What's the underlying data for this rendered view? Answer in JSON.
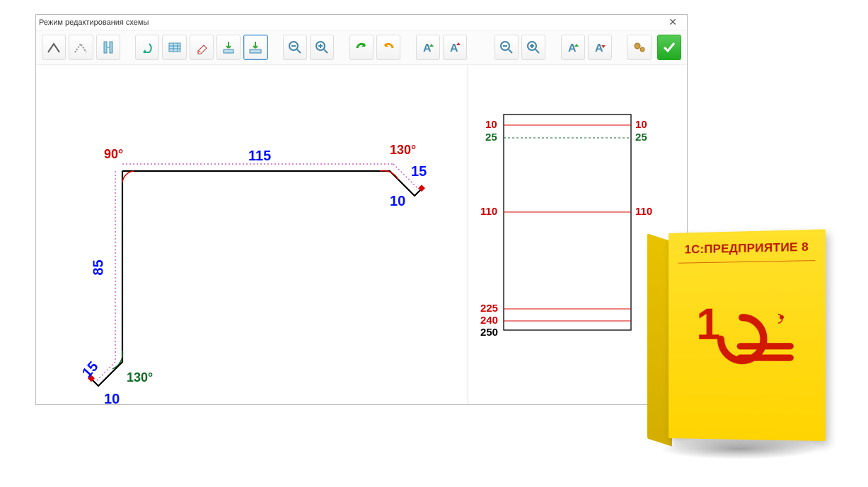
{
  "window": {
    "title": "Режим редактирования схемы"
  },
  "toolbar": {
    "icons": [
      "angle-solid",
      "angle-dotted",
      "column-spacing",
      "undo",
      "table",
      "eraser",
      "import-down",
      "import-down-selected",
      "zoom-out",
      "zoom-in",
      "redo-green",
      "undo-orange",
      "font-inc-1",
      "font-dec-1",
      "zoom-out-2",
      "zoom-in-2",
      "font-inc-2",
      "font-dec-2",
      "gear-two",
      "confirm"
    ]
  },
  "scheme": {
    "angle_tl": "90°",
    "angle_tr": "130°",
    "angle_bl": "130°",
    "len_top": "115",
    "len_left": "85",
    "len_tr_diag": "15",
    "len_tr_end": "10",
    "len_bl_diag": "15",
    "len_bl_end": "10"
  },
  "profile": {
    "left": [
      "10",
      "25",
      "110",
      "225",
      "240",
      "250"
    ],
    "right": [
      "10",
      "25",
      "110"
    ]
  },
  "product": {
    "brand": "1С:ПРЕДПРИЯТИЕ 8"
  }
}
